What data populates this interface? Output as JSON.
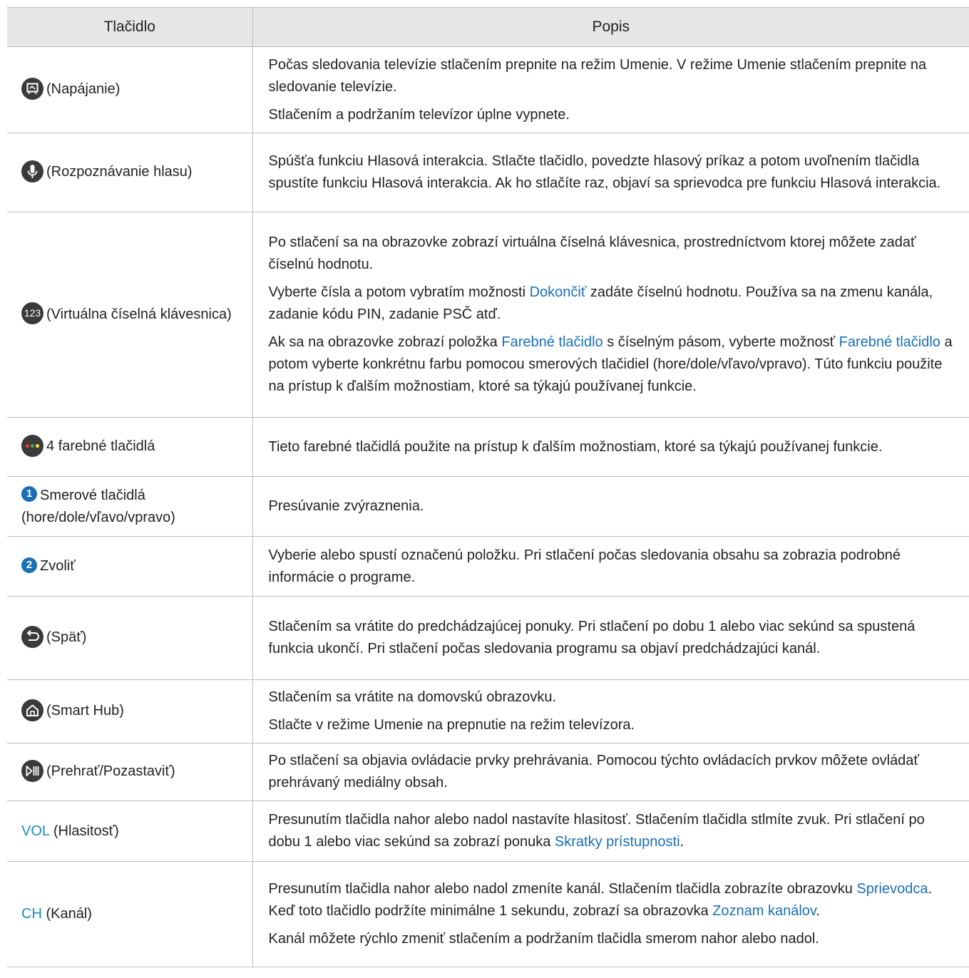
{
  "header": {
    "col1": "Tlačidlo",
    "col2": "Popis"
  },
  "rows": [
    {
      "key": {
        "icon": "power-art-icon",
        "label": "(Napájanie)"
      },
      "p": [
        "Počas sledovania televízie stlačením prepnite na režim Umenie. V režime Umenie stlačením prepnite na sledovanie televízie.",
        "Stlačením a podržaním televízor úplne vypnete."
      ]
    },
    {
      "key": {
        "icon": "microphone-icon",
        "label": "(Rozpoznávanie hlasu)"
      },
      "p": [
        "Spúšťa funkciu Hlasová interakcia. Stlačte tlačidlo, povedzte hlasový príkaz a potom uvoľnením tlačidla spustíte funkciu Hlasová interakcia. Ak ho stlačíte raz, objaví sa sprievodca pre funkciu Hlasová interakcia."
      ]
    },
    {
      "key": {
        "icon": "number-pad-icon",
        "icon_text": "123",
        "label": "(Virtuálna číselná klávesnica)"
      },
      "p": [
        "Po stlačení sa na obrazovke zobrazí virtuálna číselná klávesnica, prostredníctvom ktorej môžete zadať číselnú hodnotu."
      ],
      "p2": {
        "a": "Vyberte čísla a potom vybratím možnosti ",
        "b": "Dokončiť",
        "c": " zadáte číselnú hodnotu. Používa sa na zmenu kanála, zadanie kódu PIN, zadanie PSČ atď."
      },
      "p3": {
        "a": "Ak sa na obrazovke zobrazí položka ",
        "b": "Farebné tlačidlo",
        "c": " s číselným pásom, vyberte možnosť ",
        "d": "Farebné tlačidlo",
        "e": " a potom vyberte konkrétnu farbu pomocou smerových tlačidiel (hore/dole/vľavo/vpravo). Túto funkciu použite na prístup k ďalším možnostiam, ktoré sa týkajú používanej funkcie."
      }
    },
    {
      "key": {
        "icon": "color-dots-icon",
        "label": "4 farebné tlačidlá"
      },
      "p": [
        "Tieto farebné tlačidlá použite na prístup k ďalším možnostiam, ktoré sa týkajú používanej funkcie."
      ]
    },
    {
      "key": {
        "number": "1",
        "label": "Smerové tlačidlá (hore/dole/vľavo/vpravo)"
      },
      "p": [
        "Presúvanie zvýraznenia."
      ]
    },
    {
      "key": {
        "number": "2",
        "label": "Zvoliť"
      },
      "p": [
        "Vyberie alebo spustí označenú položku. Pri stlačení počas sledovania obsahu sa zobrazia podrobné informácie o programe."
      ]
    },
    {
      "key": {
        "icon": "back-arrow-icon",
        "label": "(Späť)"
      },
      "p": [
        "Stlačením sa vrátite do predchádzajúcej ponuky. Pri stlačení po dobu 1 alebo viac sekúnd sa spustená funkcia ukončí. Pri stlačení počas sledovania programu sa objaví predchádzajúci kanál."
      ]
    },
    {
      "key": {
        "icon": "home-icon",
        "label": "(Smart Hub)"
      },
      "p": [
        "Stlačením sa vrátite na domovskú obrazovku.",
        "Stlačte v režime Umenie na prepnutie na režim televízora."
      ]
    },
    {
      "key": {
        "icon": "play-pause-icon",
        "label": "(Prehrať/Pozastaviť)"
      },
      "p": [
        "Po stlačení sa objavia ovládacie prvky prehrávania. Pomocou týchto ovládacích prvkov môžete ovládať prehrávaný mediálny obsah."
      ]
    },
    {
      "key": {
        "kw": "VOL",
        "label": "(Hlasitosť)"
      },
      "p2": {
        "a": "Presunutím tlačidla nahor alebo nadol nastavíte hlasitosť. Stlačením tlačidla stlmíte zvuk. Pri stlačení po dobu 1 alebo viac sekúnd sa zobrazí ponuka ",
        "b": "Skratky prístupnosti",
        "c": "."
      }
    },
    {
      "key": {
        "kw": "CH",
        "label": "(Kanál)"
      },
      "p2": {
        "a": "Presunutím tlačidla nahor alebo nadol zmeníte kanál. Stlačením tlačidla zobrazíte obrazovku ",
        "b": "Sprievodca",
        "c": ". Keď toto tlačidlo podržíte minimálne 1 sekundu, zobrazí sa obrazovka ",
        "d": "Zoznam kanálov",
        "e": "."
      },
      "p": [
        "Kanál môžete rýchlo zmeniť stlačením a podržaním tlačidla smerom nahor alebo nadol."
      ]
    }
  ],
  "colors": {
    "link": "#1a6fb8",
    "header_bg": "#e6e6e6",
    "icon_bg": "#3a3a3a",
    "number_badge": "#1b6fb4"
  }
}
